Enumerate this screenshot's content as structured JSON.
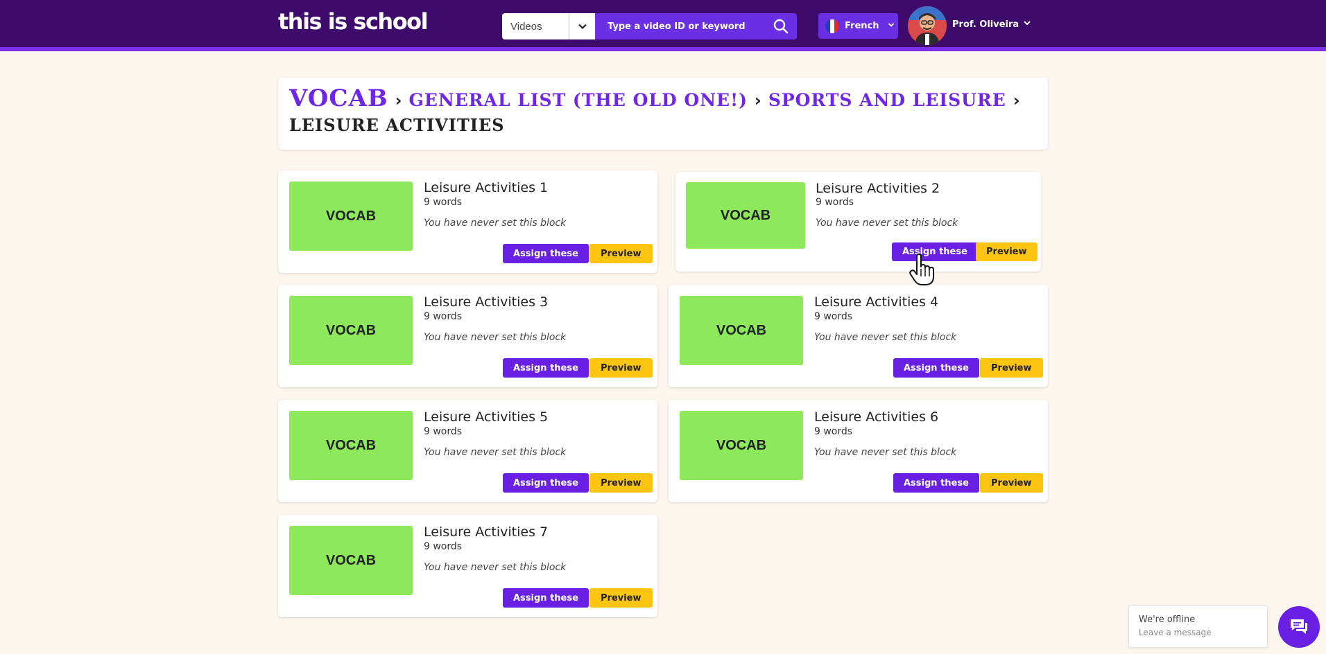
{
  "header": {
    "logo": "this is school",
    "search_type": "Videos",
    "search_placeholder": "Type a video ID or keyword",
    "language": "French",
    "user_name": "Prof. Oliveira"
  },
  "breadcrumb": {
    "root": "VOCAB",
    "level1": "GENERAL LIST (THE OLD ONE!)",
    "level2": "SPORTS AND LEISURE",
    "current": "LEISURE ACTIVITIES"
  },
  "cards": [
    {
      "thumb": "VOCAB",
      "title": "Leisure Activities 1",
      "count": "9 words",
      "status": "You have never set this block",
      "assign": "Assign these",
      "preview": "Preview"
    },
    {
      "thumb": "VOCAB",
      "title": "Leisure Activities 2",
      "count": "9 words",
      "status": "You have never set this block",
      "assign": "Assign these",
      "preview": "Preview"
    },
    {
      "thumb": "VOCAB",
      "title": "Leisure Activities 3",
      "count": "9 words",
      "status": "You have never set this block",
      "assign": "Assign these",
      "preview": "Preview"
    },
    {
      "thumb": "VOCAB",
      "title": "Leisure Activities 4",
      "count": "9 words",
      "status": "You have never set this block",
      "assign": "Assign these",
      "preview": "Preview"
    },
    {
      "thumb": "VOCAB",
      "title": "Leisure Activities 5",
      "count": "9 words",
      "status": "You have never set this block",
      "assign": "Assign these",
      "preview": "Preview"
    },
    {
      "thumb": "VOCAB",
      "title": "Leisure Activities 6",
      "count": "9 words",
      "status": "You have never set this block",
      "assign": "Assign these",
      "preview": "Preview"
    },
    {
      "thumb": "VOCAB",
      "title": "Leisure Activities 7",
      "count": "9 words",
      "status": "You have never set this block",
      "assign": "Assign these",
      "preview": "Preview"
    }
  ],
  "chat": {
    "status": "We're offline",
    "message": "Leave a message"
  },
  "colors": {
    "header_bg": "#3d0b6b",
    "accent_purple": "#6a1fe4",
    "thumb_green": "#8ee85b",
    "preview_yellow": "#fcc511",
    "page_bg": "#fdf6ee"
  }
}
